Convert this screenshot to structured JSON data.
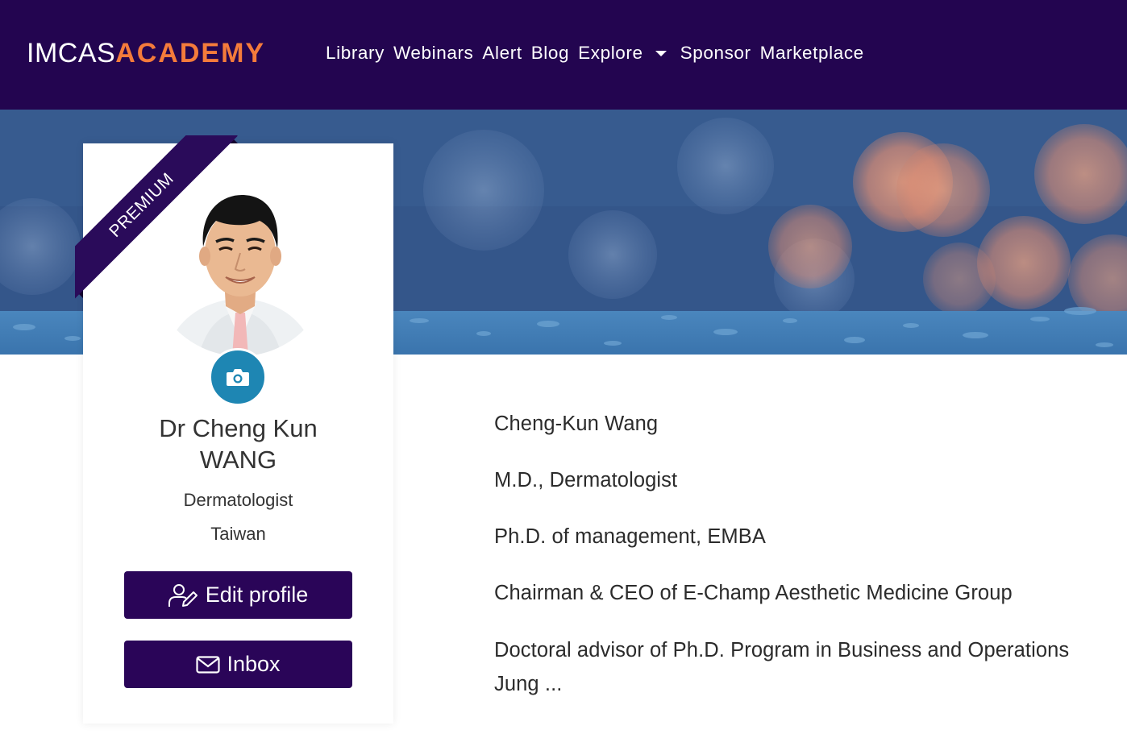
{
  "nav": {
    "brand": {
      "part1": "IMCAS",
      "part2": "ACADEMY"
    },
    "links": [
      {
        "label": "Library"
      },
      {
        "label": "Webinars"
      },
      {
        "label": "Alert"
      },
      {
        "label": "Blog"
      },
      {
        "label": "Explore",
        "dropdown": true
      },
      {
        "label": "Sponsor"
      },
      {
        "label": "Marketplace"
      }
    ]
  },
  "profile": {
    "ribbon": "PREMIUM",
    "name": "Dr Cheng Kun WANG",
    "specialty": "Dermatologist",
    "country": "Taiwan",
    "edit_label": "Edit profile",
    "inbox_label": "Inbox",
    "camera_icon": "camera-icon"
  },
  "bio": {
    "lines": [
      "Cheng-Kun Wang",
      "M.D., Dermatologist",
      "Ph.D. of management, EMBA",
      "Chairman & CEO of E-Champ Aesthetic Medicine Group",
      "Doctoral advisor of Ph.D. Program in Business and Operations",
      "Jung ..."
    ]
  },
  "colors": {
    "nav_bg": "#230550",
    "brand_accent": "#f47b3b",
    "button_bg": "#2a0558",
    "camera_bg": "#1e86b3"
  }
}
